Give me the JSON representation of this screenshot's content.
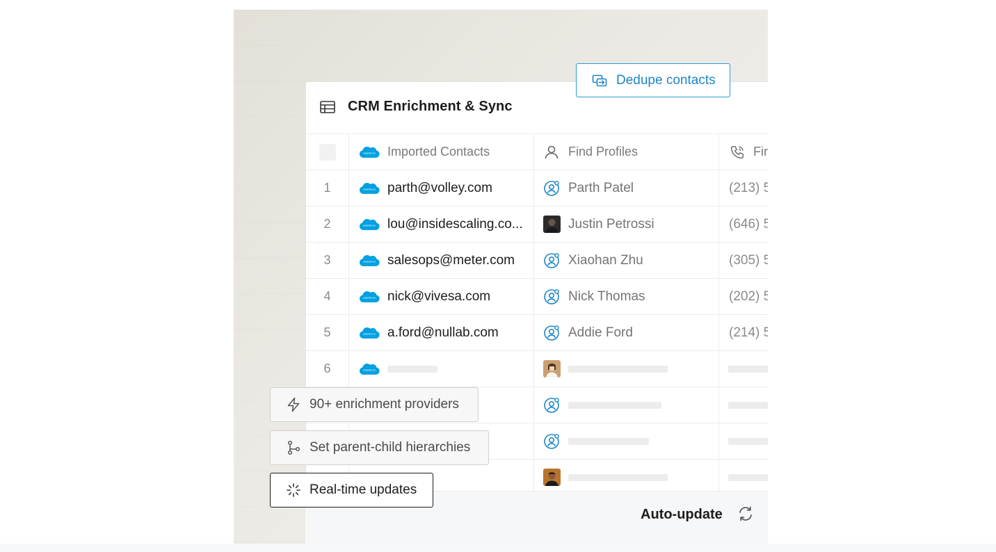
{
  "header": {
    "title": "CRM Enrichment & Sync"
  },
  "dedupe_button": {
    "label": "Dedupe contacts",
    "color": "#1d86c6"
  },
  "columns": {
    "imported": "Imported Contacts",
    "profiles": "Find Profiles",
    "phone": "Fir"
  },
  "rows": [
    {
      "num": "1",
      "email": "parth@volley.com",
      "profile": "Parth Patel",
      "phone": "(213) 5",
      "profile_icon": "user-sync-icon"
    },
    {
      "num": "2",
      "email": "lou@insidescaling.co...",
      "profile": "Justin Petrossi",
      "phone": "(646) 5",
      "profile_icon": "avatar-photo"
    },
    {
      "num": "3",
      "email": "salesops@meter.com",
      "profile": "Xiaohan Zhu",
      "phone": "(305) 5",
      "profile_icon": "user-sync-icon"
    },
    {
      "num": "4",
      "email": "nick@vivesa.com",
      "profile": "Nick Thomas",
      "phone": "(202) 5",
      "profile_icon": "user-sync-icon"
    },
    {
      "num": "5",
      "email": "a.ford@nullab.com",
      "profile": "Addie Ford",
      "phone": "(214) 5",
      "profile_icon": "user-sync-icon"
    },
    {
      "num": "6",
      "email": "",
      "profile": "",
      "phone": "",
      "profile_icon": "avatar-photo"
    },
    {
      "num": "",
      "email": "",
      "profile": "",
      "phone": "",
      "profile_icon": "user-sync-icon"
    },
    {
      "num": "",
      "email": "",
      "profile": "",
      "phone": "",
      "profile_icon": "user-sync-icon"
    },
    {
      "num": "",
      "email": "",
      "profile": "",
      "phone": "",
      "profile_icon": "avatar-photo"
    }
  ],
  "chips": [
    {
      "label": "90+ enrichment providers",
      "icon": "lightning-icon"
    },
    {
      "label": "Set parent-child hierarchies",
      "icon": "git-branch-icon"
    },
    {
      "label": "Real-time updates",
      "icon": "loading-spinner-icon"
    }
  ],
  "footer": {
    "label": "Auto-update",
    "icon": "refresh-icon"
  },
  "colors": {
    "accent": "#1d86c6",
    "salesforce": "#00a1e0"
  }
}
